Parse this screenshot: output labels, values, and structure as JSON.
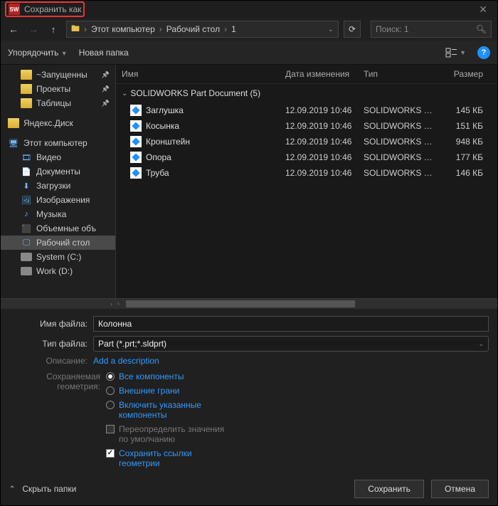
{
  "title": "Сохранить как",
  "nav": {
    "path": [
      "Этот компьютер",
      "Рабочий стол",
      "1"
    ],
    "search_placeholder": "Поиск: 1"
  },
  "toolbar": {
    "organize": "Упорядочить",
    "new_folder": "Новая папка"
  },
  "sidebar": {
    "items": [
      {
        "label": "~Запущенны",
        "icon": "folder",
        "pinned": true,
        "indent": "sub"
      },
      {
        "label": "Проекты",
        "icon": "folder",
        "pinned": true,
        "indent": "sub"
      },
      {
        "label": "Таблицы",
        "icon": "folder",
        "pinned": true,
        "indent": "sub"
      },
      {
        "gap": true
      },
      {
        "label": "Яндекс.Диск",
        "icon": "folder",
        "indent": "root"
      },
      {
        "gap": true
      },
      {
        "label": "Этот компьютер",
        "icon": "pc",
        "indent": "root"
      },
      {
        "label": "Видео",
        "icon": "video",
        "indent": "sub"
      },
      {
        "label": "Документы",
        "icon": "docs",
        "indent": "sub"
      },
      {
        "label": "Загрузки",
        "icon": "down",
        "indent": "sub"
      },
      {
        "label": "Изображения",
        "icon": "img",
        "indent": "sub"
      },
      {
        "label": "Музыка",
        "icon": "music",
        "indent": "sub"
      },
      {
        "label": "Объемные объ",
        "icon": "obj",
        "indent": "sub"
      },
      {
        "label": "Рабочий стол",
        "icon": "desk",
        "indent": "sub",
        "selected": true
      },
      {
        "label": "System (C:)",
        "icon": "disk",
        "indent": "sub"
      },
      {
        "label": "Work (D:)",
        "icon": "disk",
        "indent": "sub"
      }
    ]
  },
  "filelist": {
    "columns": {
      "name": "Имя",
      "date": "Дата изменения",
      "type": "Тип",
      "size": "Размер"
    },
    "group": "SOLIDWORKS Part Document (5)",
    "rows": [
      {
        "name": "Заглушка",
        "date": "12.09.2019 10:46",
        "type": "SOLIDWORKS Part...",
        "size": "145 КБ"
      },
      {
        "name": "Косынка",
        "date": "12.09.2019 10:46",
        "type": "SOLIDWORKS Part...",
        "size": "151 КБ"
      },
      {
        "name": "Кронштейн",
        "date": "12.09.2019 10:46",
        "type": "SOLIDWORKS Part...",
        "size": "948 КБ"
      },
      {
        "name": "Опора",
        "date": "12.09.2019 10:46",
        "type": "SOLIDWORKS Part...",
        "size": "177 КБ"
      },
      {
        "name": "Труба",
        "date": "12.09.2019 10:46",
        "type": "SOLIDWORKS Part...",
        "size": "146 КБ"
      }
    ]
  },
  "form": {
    "name_label": "Имя файла:",
    "name_value": "Колонна",
    "type_label": "Тип файла:",
    "type_value": "Part (*.prt;*.sldprt)",
    "desc_label": "Описание:",
    "desc_value": "Add a description",
    "geom_label": "Сохраняемая геометрия:",
    "opts": {
      "all": "Все компоненты",
      "ext": "Внешние грани",
      "inc": "Включить указанные компоненты",
      "ovd": "Переопределить значения по умолчанию",
      "links": "Сохранить ссылки геометрии"
    }
  },
  "footer": {
    "hide": "Скрыть папки",
    "save": "Сохранить",
    "cancel": "Отмена"
  }
}
